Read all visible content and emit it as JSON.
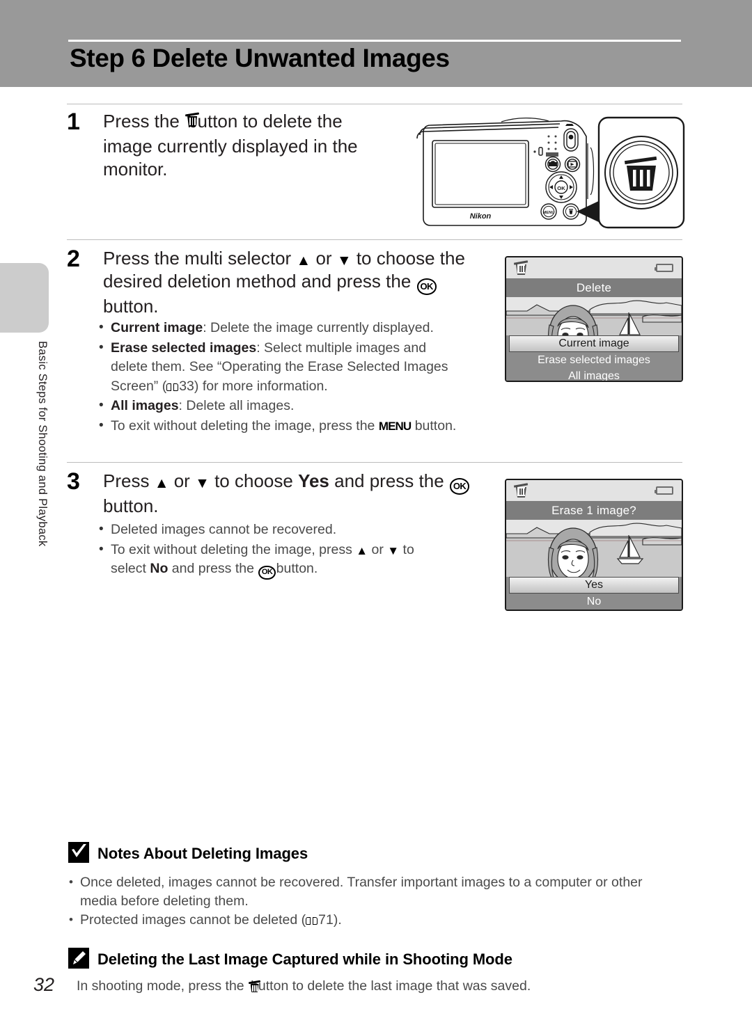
{
  "header": {
    "title": "Step 6 Delete Unwanted Images",
    "band_color": "#999999"
  },
  "sidebar": {
    "chapter_label": "Basic Steps for Shooting and Playback",
    "tab_color": "#cccccc"
  },
  "steps": [
    {
      "number": "1",
      "text_before_icon": "Press the ",
      "icon": "trash-icon",
      "text_after_icon": " button to delete the image currently displayed in the monitor.",
      "bullets": []
    },
    {
      "number": "2",
      "text": "Press the multi selector ▲ or ▼ to choose the desired deletion method and press the OK button.",
      "bullets": [
        {
          "label": "Current image",
          "text": ": Delete the image currently displayed."
        },
        {
          "label": "Erase selected images",
          "text": ": Select multiple images and delete them. See “Operating the Erase Selected Images Screen” (",
          "page_ref": "33",
          "text_end": ") for more information."
        },
        {
          "label": "All images",
          "text": ": Delete all images."
        },
        {
          "label": "",
          "text": "To exit without deleting the image, press the MENU button."
        }
      ]
    },
    {
      "number": "3",
      "text": "Press ▲ or ▼ to choose Yes and press the OK button.",
      "bullets": [
        {
          "label": "",
          "text": "Deleted images cannot be recovered."
        },
        {
          "label": "",
          "text": "To exit without deleting the image, press ▲ or ▼ to select No and press the OK button."
        }
      ]
    }
  ],
  "step2_text_parts": {
    "a": "Press the multi selector ",
    "b": " or ",
    "c": " to choose the",
    "d": "desired deletion method and press the ",
    "e": "button."
  },
  "step3_text_parts": {
    "a": "Press ",
    "b": " or ",
    "c": " to choose ",
    "yes": "Yes",
    "d": " and press the ",
    "e": "button."
  },
  "step1_text_parts": {
    "a": "Press the ",
    "b": " button to delete the",
    "c": "image currently displayed in the",
    "d": "monitor."
  },
  "bullet_text": {
    "b2_1_label": "Current image",
    "b2_1_text": ": Delete the image currently displayed.",
    "b2_2_label": "Erase selected images",
    "b2_2_text": ": Select multiple images and",
    "b2_2_text2": "delete them. See “Operating the Erase Selected Images",
    "b2_2_text3a": "Screen” (",
    "b2_2_ref": "33",
    "b2_2_text3b": ") for more information.",
    "b2_3_label": "All images",
    "b2_3_text": ": Delete all images.",
    "b2_4_a": "To exit without deleting the image, press the ",
    "b2_4_menu": "MENU",
    "b2_4_b": " button.",
    "b3_1": "Deleted images cannot be recovered.",
    "b3_2a": "To exit without deleting the image, press ",
    "b3_2b": " or ",
    "b3_2c": " to",
    "b3_2d": "select ",
    "b3_2no": "No",
    "b3_2e": " and press the ",
    "b3_2f": "button."
  },
  "camera": {
    "brand_mark": "Nikon",
    "callout_icon": "trash-icon",
    "ok_label": "OK",
    "menu_label": "MENU"
  },
  "lcd_screens": [
    {
      "id": "delete-menu",
      "status_icons": [
        "trash-icon",
        "battery-icon"
      ],
      "title": "Delete",
      "options": [
        {
          "label": "Current image",
          "selected": true
        },
        {
          "label": "Erase selected images",
          "selected": false
        },
        {
          "label": "All images",
          "selected": false
        }
      ]
    },
    {
      "id": "erase-confirm",
      "status_icons": [
        "trash-icon",
        "battery-icon"
      ],
      "title": "Erase 1 image?",
      "options": [
        {
          "label": "Yes",
          "selected": true
        },
        {
          "label": "No",
          "selected": false
        }
      ]
    }
  ],
  "notes_section": {
    "badge_icon": "checkmark-box-icon",
    "title": "Notes About Deleting Images",
    "bullets": [
      "Once deleted, images cannot be recovered. Transfer important images to a computer or other media before deleting them.",
      "Protected images cannot be deleted ("
    ],
    "bullet1_line1": "Once deleted, images cannot be recovered. Transfer important images to a computer or other",
    "bullet1_line2": "media before deleting them.",
    "bullet2_a": "Protected images cannot be deleted (",
    "bullet2_ref": "71",
    "bullet2_b": ")."
  },
  "tip_section": {
    "badge_icon": "pencil-box-icon",
    "title": "Deleting the Last Image Captured while in Shooting Mode",
    "body_a": "In shooting mode, press the ",
    "body_b": " button to delete the last image that was saved."
  },
  "page_number": "32"
}
